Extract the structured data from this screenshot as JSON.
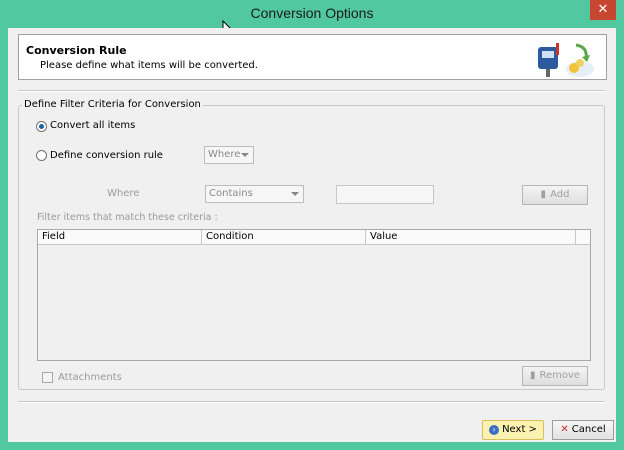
{
  "window": {
    "title": "Conversion Options",
    "close_glyph": "✕"
  },
  "header": {
    "title": "Conversion Rule",
    "subtitle": "Please define what items will be converted.",
    "art_icon": "mailbox-conversion-icon"
  },
  "filter_group": {
    "legend": "Define Filter Criteria for Conversion",
    "option_all": {
      "label": "Convert all items",
      "selected": true
    },
    "option_rule": {
      "label": "Define conversion rule",
      "selected": false
    },
    "where_dropdown": {
      "value": "Where"
    },
    "where_label": "Where",
    "condition_dropdown": {
      "value": "Contains"
    },
    "value_input": {
      "value": ""
    },
    "add_button": "Add",
    "filter_hint": "Filter items that match these criteria :",
    "columns": [
      "Field",
      "Condition",
      "Value"
    ],
    "rows": [],
    "attachments": {
      "label": "Attachments",
      "checked": false
    },
    "remove_button": "Remove"
  },
  "footer": {
    "next_button": "Next >",
    "cancel_button": "Cancel"
  },
  "colors": {
    "titlebar": "#52c8a0",
    "close": "#c7462f",
    "next_bg": "#fbf1b0"
  }
}
